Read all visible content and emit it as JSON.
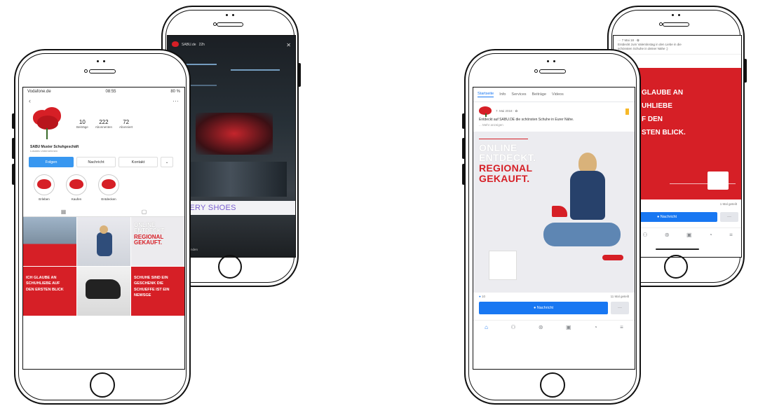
{
  "instagram": {
    "status": {
      "carrier": "Vodafone.de",
      "time": "08:55",
      "battery": "80 %"
    },
    "stats": [
      {
        "num": "10",
        "label": "Beiträge"
      },
      {
        "num": "222",
        "label": "Abonnenten"
      },
      {
        "num": "72",
        "label": "Abonniert"
      }
    ],
    "name": "SABU Muster Schuhgeschäft",
    "category": "Lokales Unternehmen",
    "buttons": {
      "follow": "Folgen",
      "message": "Nachricht",
      "contact": "Kontakt",
      "more": "⌄"
    },
    "highlights": [
      "Erleben",
      "Kaufen",
      "Entdecken"
    ],
    "grid": [
      {
        "type": "photo-building"
      },
      {
        "type": "photo-woman"
      },
      {
        "type": "ad-online",
        "lines": [
          "ONLINE",
          "ENTDECKT",
          "REGIONAL",
          "GEKAUFT."
        ]
      },
      {
        "type": "ad-red",
        "text": "ICH GLAUBE AN SCHUHLIEBE AUF DEN ERSTEN BLICK"
      },
      {
        "type": "photo-shoes"
      },
      {
        "type": "ad-red",
        "text": "SCHUHE SIND EIN GESCHENK DIE SCHUEFFE IST EIN NEWSGE"
      }
    ]
  },
  "story": {
    "account": "SABU.de",
    "time": "22h",
    "banner": "GALLERY SHOES",
    "reply": "Nachricht senden"
  },
  "facebook": {
    "tabs": [
      "Startseite",
      "Info",
      "Services",
      "Beiträge",
      "Videos"
    ],
    "post_time": "7. Mai 2018 · ✿",
    "post_text": "Entdeckt auf SABU.DE die schönsten Schuhe in Eurer Nähe.",
    "more": "... Mehr anzeigen",
    "headline": [
      "ONLINE",
      "ENTDECKT.",
      "REGIONAL",
      "GEKAUFT."
    ],
    "reactions_count": "10",
    "shares": "11 Mal geteilt",
    "message_button": "● Nachricht",
    "dots": "···",
    "nav": [
      "⌂",
      "⚇",
      "⊛",
      "▣",
      "◔",
      "≡"
    ]
  },
  "facebook2": {
    "header_line1": "··· 7 Mai 18 · ✿",
    "header_line2": "Entdeckt zum Valentinstag in den Liebe in die",
    "header_line3": "schönsten Schuhe in deiner Nähe ;)",
    "ad_lines": [
      "GLAUBE AN",
      "UHLIEBE",
      "F DEN",
      "STEN BLICK."
    ],
    "shares": "1 Mal geteilt",
    "message_button": "● Nachricht",
    "dots": "···",
    "nav": [
      "⌂",
      "⚇",
      "⊛",
      "▣",
      "◔",
      "≡"
    ]
  }
}
